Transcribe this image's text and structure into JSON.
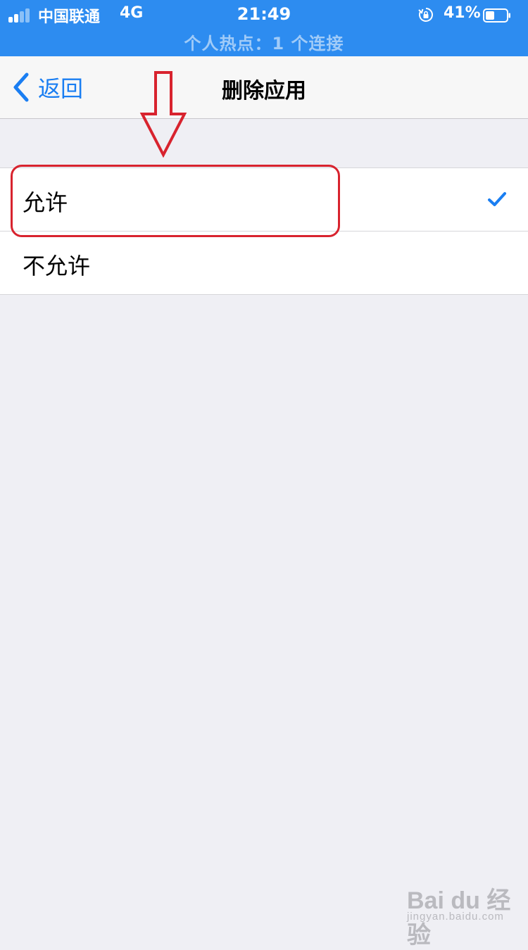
{
  "status_bar": {
    "carrier": "中国联通",
    "network": "4G",
    "time": "21:49",
    "battery_percent": "41%",
    "hotspot_text": "个人热点：1 个连接",
    "bg_color": "#2d8cf0"
  },
  "nav": {
    "back_label": "返回",
    "title": "删除应用",
    "accent_color": "#1a7ef2"
  },
  "options": [
    {
      "label": "允许",
      "selected": true
    },
    {
      "label": "不允许",
      "selected": false
    }
  ],
  "annotation": {
    "color": "#d8232e",
    "icon": "down-arrow-icon"
  },
  "watermark": {
    "main": "Bai du 经验",
    "sub": "jingyan.baidu.com"
  }
}
